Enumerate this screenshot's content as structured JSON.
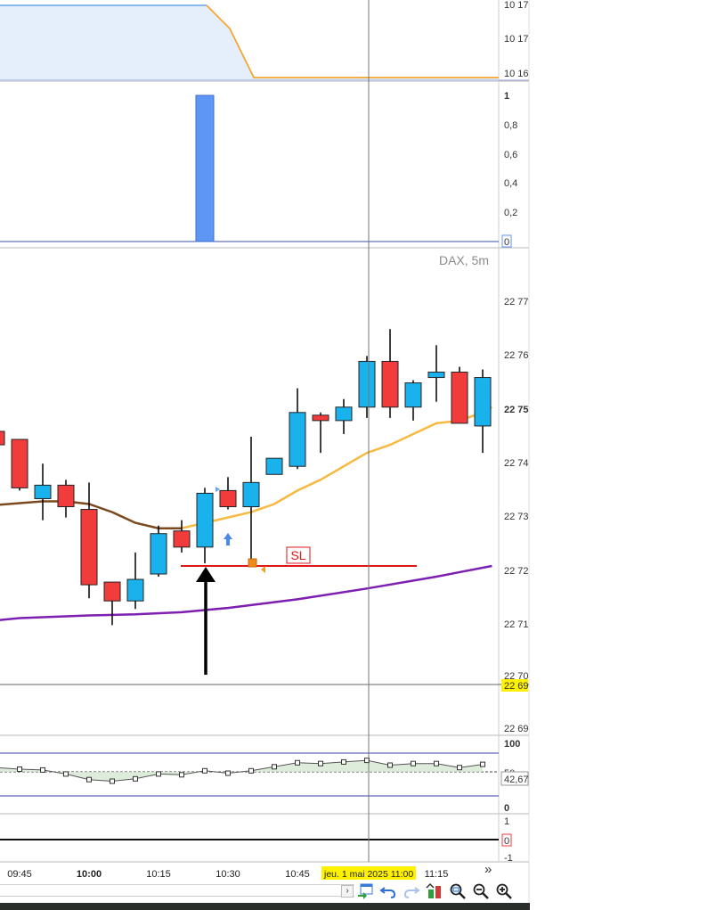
{
  "instrument_label": "DAX, 5m",
  "crosshair_date_label": "jeu. 1 mai 2025 11:00",
  "colors": {
    "bull": "#1ab2ec",
    "bear": "#f23b3b",
    "ma_fast_past": "#7a4a1e",
    "ma_fast": "#f6b942",
    "ma_slow": "#7d1fb0",
    "stop_loss": "#e01515",
    "top_fill": "#e5eefb",
    "top_line_blue": "#6aa3ee",
    "top_line_orange": "#f5a530",
    "hist_bar": "#5e96f5",
    "osc_fill": "#d6e8d2",
    "highlight": "#fff200"
  },
  "chart_data": [
    {
      "type": "area",
      "panel": "top",
      "y_tick_labels": [
        "10 17",
        "10 17",
        "10 16"
      ],
      "series": [
        {
          "x": [
            "09:40",
            "10:20",
            "10:25",
            "10:30",
            "11:25"
          ],
          "values": [
            3,
            3,
            2.2,
            1,
            1
          ]
        }
      ]
    },
    {
      "type": "bar",
      "panel": "histogram",
      "y_tick_labels": [
        "1",
        "0,8",
        "0,6",
        "0,4",
        "0,2",
        "0"
      ],
      "ylim": [
        0,
        1
      ],
      "categories": [
        "10:25"
      ],
      "values": [
        1
      ]
    },
    {
      "type": "candlestick",
      "panel": "price",
      "title": "DAX, 5m",
      "y_tick_labels": [
        "22 77",
        "22 76",
        "22 75",
        "22 74",
        "22 73",
        "22 72",
        "22 71",
        "22 70",
        "22 69",
        "22 69"
      ],
      "highlighted_tick": "22 69",
      "candles": [
        {
          "t": "09:40",
          "open": 22746.0,
          "high": 22748.0,
          "low": 22744.0,
          "close": 22743.5
        },
        {
          "t": "09:45",
          "open": 22744.5,
          "high": 22744.5,
          "low": 22735.0,
          "close": 22735.5
        },
        {
          "t": "09:50",
          "open": 22733.5,
          "high": 22740.0,
          "low": 22729.5,
          "close": 22736.0
        },
        {
          "t": "09:55",
          "open": 22736.0,
          "high": 22737.0,
          "low": 22730.0,
          "close": 22732.0
        },
        {
          "t": "10:00",
          "open": 22731.5,
          "high": 22736.5,
          "low": 22715.0,
          "close": 22717.5
        },
        {
          "t": "10:05",
          "open": 22718.0,
          "high": 22718.0,
          "low": 22710.0,
          "close": 22714.5
        },
        {
          "t": "10:10",
          "open": 22714.5,
          "high": 22723.5,
          "low": 22713.0,
          "close": 22718.5
        },
        {
          "t": "10:15",
          "open": 22719.5,
          "high": 22728.5,
          "low": 22719.0,
          "close": 22727.0
        },
        {
          "t": "10:20",
          "open": 22727.5,
          "high": 22729.5,
          "low": 22723.5,
          "close": 22724.5
        },
        {
          "t": "10:25",
          "open": 22724.5,
          "high": 22735.5,
          "low": 22721.5,
          "close": 22734.5
        },
        {
          "t": "10:30",
          "open": 22735.0,
          "high": 22737.5,
          "low": 22731.5,
          "close": 22732.0
        },
        {
          "t": "10:35",
          "open": 22732.0,
          "high": 22745.0,
          "low": 22721.0,
          "close": 22736.5
        },
        {
          "t": "10:40",
          "open": 22738.0,
          "high": 22741.0,
          "low": 22738.0,
          "close": 22741.0
        },
        {
          "t": "10:45",
          "open": 22739.5,
          "high": 22754.0,
          "low": 22739.0,
          "close": 22749.5
        },
        {
          "t": "10:50",
          "open": 22749.0,
          "high": 22749.5,
          "low": 22742.0,
          "close": 22748.0
        },
        {
          "t": "10:55",
          "open": 22748.0,
          "high": 22752.0,
          "low": 22745.5,
          "close": 22750.5
        },
        {
          "t": "11:00",
          "open": 22750.5,
          "high": 22760.0,
          "low": 22748.5,
          "close": 22759.0
        },
        {
          "t": "11:05",
          "open": 22759.0,
          "high": 22765.0,
          "low": 22748.5,
          "close": 22750.5
        },
        {
          "t": "11:10",
          "open": 22750.5,
          "high": 22755.5,
          "low": 22748.0,
          "close": 22755.0
        },
        {
          "t": "11:15",
          "open": 22756.0,
          "high": 22762.0,
          "low": 22751.5,
          "close": 22757.0
        },
        {
          "t": "11:20",
          "open": 22757.0,
          "high": 22758.0,
          "low": 22747.5,
          "close": 22747.5
        },
        {
          "t": "11:25",
          "open": 22747.0,
          "high": 22757.5,
          "low": 22742.0,
          "close": 22756.0
        }
      ],
      "ma_fast_past": {
        "x": [
          "09:35",
          "09:50",
          "09:55",
          "10:00",
          "10:05",
          "10:10",
          "10:15",
          "10:20"
        ],
        "values": [
          22732.0,
          22733.0,
          22733.0,
          22732.5,
          22731.0,
          22729.0,
          22728.0,
          22728.0
        ]
      },
      "ma_fast": {
        "x": [
          "10:20",
          "10:25",
          "10:30",
          "10:35",
          "10:40",
          "10:45",
          "10:50",
          "10:55",
          "11:00",
          "11:05",
          "11:10",
          "11:15",
          "11:20",
          "11:25",
          "11:27"
        ],
        "values": [
          22728.0,
          22729.0,
          22730.0,
          22731.0,
          22732.5,
          22735.0,
          22737.0,
          22739.5,
          22742.0,
          22743.5,
          22745.5,
          22747.5,
          22748.0,
          22749.5,
          22750.5
        ]
      },
      "ma_slow": {
        "x": [
          "09:35",
          "09:45",
          "10:00",
          "10:10",
          "10:20",
          "10:30",
          "10:45",
          "11:00",
          "11:15",
          "11:27"
        ],
        "values": [
          22710.5,
          22711.3,
          22711.8,
          22712.0,
          22712.4,
          22713.2,
          22714.8,
          22716.8,
          22719.0,
          22721.0
        ]
      },
      "stop_loss": {
        "label": "SL",
        "value": 22721.0,
        "from": "10:20",
        "to": "11:10"
      },
      "signal_marker_time": "10:30"
    },
    {
      "type": "line",
      "panel": "oscillator",
      "y_tick_labels": [
        "100",
        "50",
        "0"
      ],
      "current_value_label": "42,67",
      "series": [
        {
          "x": [
            "09:40",
            "09:45",
            "09:50",
            "09:55",
            "10:00",
            "10:05",
            "10:10",
            "10:15",
            "10:20",
            "10:25",
            "10:30",
            "10:35",
            "10:40",
            "10:45",
            "10:50",
            "10:55",
            "11:00",
            "11:05",
            "11:10",
            "11:15",
            "11:20",
            "11:25"
          ],
          "values": [
            48,
            46,
            45,
            40,
            33,
            31,
            34,
            40,
            39,
            44,
            41,
            44,
            49,
            54,
            53,
            55,
            57,
            51,
            53,
            53,
            48,
            52
          ]
        }
      ]
    },
    {
      "type": "line",
      "panel": "bottom",
      "y_tick_labels": [
        "1",
        "0",
        "-1"
      ],
      "series": [
        {
          "x": [
            "09:40",
            "11:27"
          ],
          "values": [
            0,
            0
          ]
        }
      ]
    }
  ],
  "time_axis": {
    "labels": [
      "09:45",
      "10:00",
      "10:15",
      "10:30",
      "10:45",
      "11:15"
    ],
    "bold_label": "10:00"
  },
  "controls": {
    "more_label": "»",
    "scroll_arrow": "›"
  }
}
